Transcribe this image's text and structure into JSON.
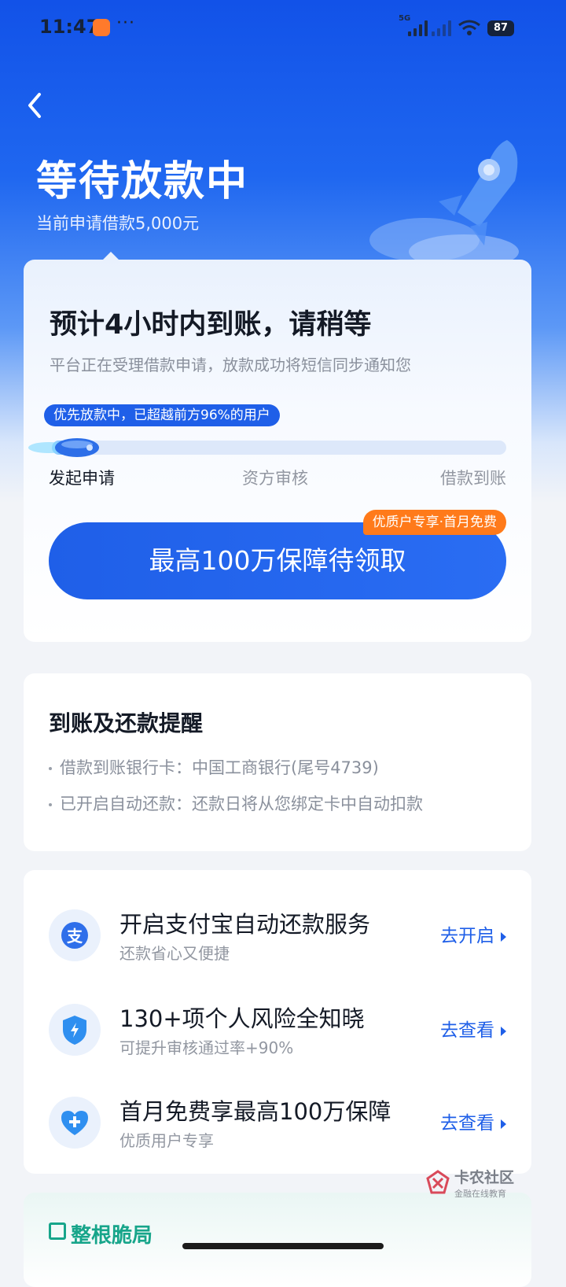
{
  "status_bar": {
    "time": "11:47",
    "more": "···",
    "network_label": "5G",
    "battery": "87"
  },
  "header": {
    "title": "等待放款中",
    "subtitle": "当前申请借款5,000元"
  },
  "progress_card": {
    "title": "预计4小时内到账，请稍等",
    "subtitle": "平台正在受理借款申请，放款成功将短信同步通知您",
    "badge": "优先放款中，已超越前方96%的用户",
    "progress_fraction": 0.08,
    "steps": [
      "发起申请",
      "资方审核",
      "借款到账"
    ],
    "cta_label": "最高100万保障待领取",
    "cta_tag": "优质户专享·首月免费"
  },
  "reminder_card": {
    "title": "到账及还款提醒",
    "items": [
      "借款到账银行卡：中国工商银行(尾号4739)",
      "已开启自动还款：还款日将从您绑定卡中自动扣款"
    ]
  },
  "services": [
    {
      "title": "开启支付宝自动还款服务",
      "subtitle": "还款省心又便捷",
      "action": "去开启",
      "icon": "alipay-icon"
    },
    {
      "title": "130+项个人风险全知晓",
      "subtitle": "可提升审核通过率+90%",
      "action": "去查看",
      "icon": "shield-bolt-icon"
    },
    {
      "title": "首月免费享最高100万保障",
      "subtitle": "优质用户专享",
      "action": "去查看",
      "icon": "heart-plus-icon"
    }
  ],
  "bottom_card": {
    "title": "整根脆局"
  },
  "watermark": {
    "name": "卡农社区",
    "tagline": "金融在线教育"
  },
  "colors": {
    "primary": "#1f5fe8",
    "accent_orange": "#ff7a1a",
    "green": "#17a58a"
  }
}
